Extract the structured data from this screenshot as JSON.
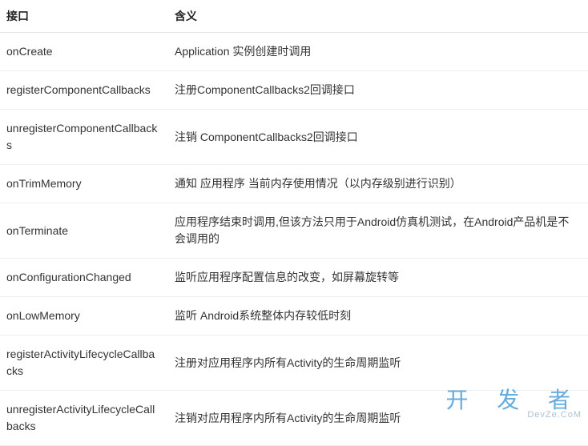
{
  "table": {
    "headers": {
      "col1": "接口",
      "col2": "含义"
    },
    "rows": [
      {
        "iface": "onCreate",
        "meaning": "Application 实例创建时调用"
      },
      {
        "iface": "registerComponentCallbacks",
        "meaning": "注册ComponentCallbacks2回调接口"
      },
      {
        "iface": "unregisterComponentCallbacks",
        "meaning": "注销 ComponentCallbacks2回调接口"
      },
      {
        "iface": "onTrimMemory",
        "meaning": "通知 应用程序 当前内存使用情况（以内存级别进行识别）"
      },
      {
        "iface": "onTerminate",
        "meaning": "应用程序结束时调用,但该方法只用于Android仿真机测试，在Android产品机是不会调用的"
      },
      {
        "iface": "onConfigurationChanged",
        "meaning": "监听应用程序配置信息的改变，如屏幕旋转等"
      },
      {
        "iface": "onLowMemory",
        "meaning": "监听 Android系统整体内存较低时刻"
      },
      {
        "iface": "registerActivityLifecycleCallbacks",
        "meaning": "注册对应用程序内所有Activity的生命周期监听"
      },
      {
        "iface": "unregisterActivityLifecycleCallbacks",
        "meaning": "注销对应用程序内所有Activity的生命周期监听"
      }
    ]
  },
  "watermark": {
    "big": "开 发 者",
    "small": "DevZe.CoM"
  }
}
